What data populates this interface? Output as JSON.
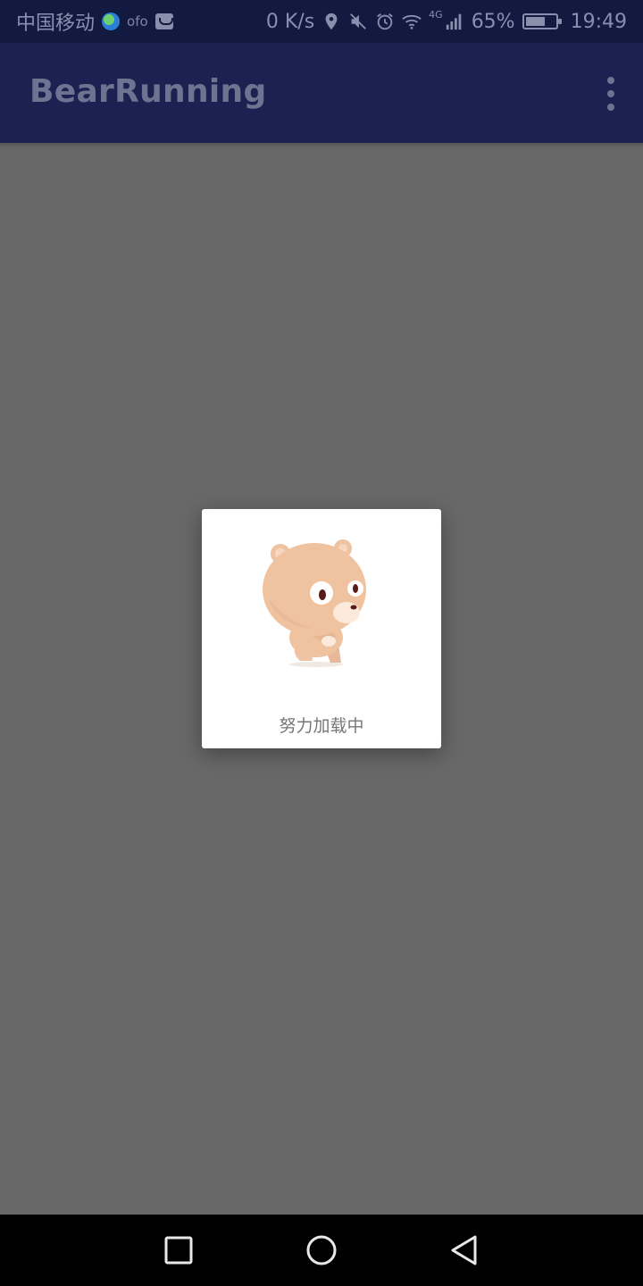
{
  "status_bar": {
    "carrier": "中国移动",
    "ofo_label": "ofo",
    "net_speed": "0 K/s",
    "network": "4G",
    "battery_percent": "65%",
    "battery_level": 0.65,
    "time": "19:49",
    "icons": [
      "globe-icon",
      "ofo-icon",
      "app-icon",
      "location-icon",
      "mute-icon",
      "alarm-icon",
      "wifi-icon",
      "signal-icon",
      "battery-icon"
    ]
  },
  "app_bar": {
    "title": "BearRunning",
    "overflow_icon": "more-vert-icon"
  },
  "dialog": {
    "image": "running-bear",
    "loading_text": "努力加载中"
  },
  "nav_bar": {
    "icons": [
      "recents-square-icon",
      "home-circle-icon",
      "back-triangle-icon"
    ]
  },
  "colors": {
    "status_bar_bg": "#121a40",
    "app_bar_bg": "#1b2150",
    "scrim": "#686868",
    "dialog_bg": "#ffffff",
    "bear_fur": "#efc2a0"
  }
}
